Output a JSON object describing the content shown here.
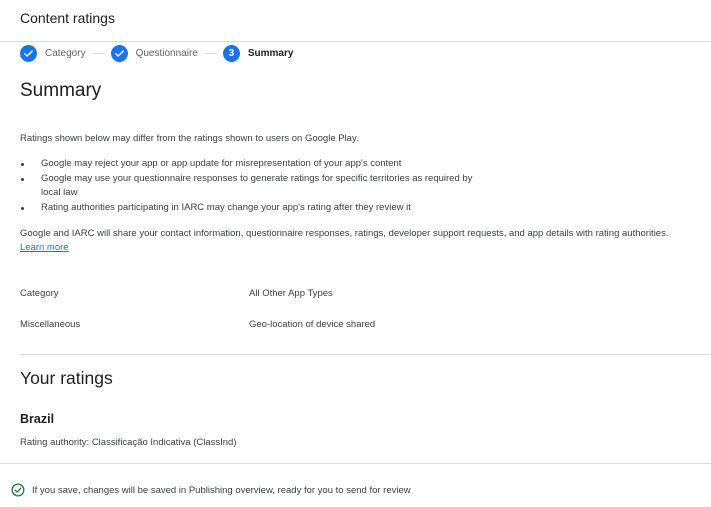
{
  "header": {
    "title": "Content ratings"
  },
  "stepper": {
    "steps": [
      {
        "label": "Category",
        "state": "done"
      },
      {
        "label": "Questionnaire",
        "state": "done"
      },
      {
        "label": "Summary",
        "state": "active",
        "number": "3"
      }
    ]
  },
  "summary": {
    "title": "Summary",
    "intro": "Ratings shown below may differ from the ratings shown to users on Google Play.",
    "bullets": [
      "Google may reject your app or app update for misrepresentation of your app's content",
      "Google may use your questionnaire responses to generate ratings for specific territories as required by local law",
      "Rating authorities participating in IARC may change your app's rating after they review it"
    ],
    "share_text": "Google and IARC will share your contact information, questionnaire responses, ratings, developer support requests, and app details with rating authorities.",
    "learn_more": "Learn more",
    "details": [
      {
        "label": "Category",
        "value": "All Other App Types"
      },
      {
        "label": "Miscellaneous",
        "value": "Geo-location of device shared"
      }
    ]
  },
  "ratings": {
    "title": "Your ratings",
    "country": "Brazil",
    "authority": "Rating authority: Classificação Indicativa (ClassInd)"
  },
  "footer": {
    "message": "If you save, changes will be saved in Publishing overview, ready for you to send for review",
    "icon": "check-circle-icon"
  },
  "colors": {
    "accent": "#1a73e8",
    "success": "#188038",
    "divider": "#dadce0"
  }
}
